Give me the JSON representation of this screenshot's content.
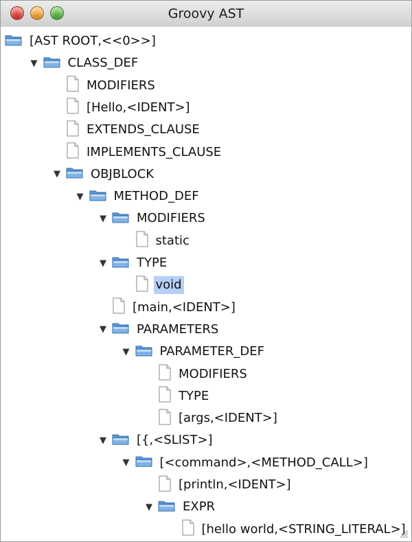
{
  "window": {
    "title": "Groovy AST"
  },
  "tree": {
    "nodes": [
      {
        "label": "[AST ROOT,<<0>>]",
        "level": 0,
        "type": "folder",
        "expanded": false
      },
      {
        "label": "CLASS_DEF",
        "level": 1,
        "type": "folder",
        "expanded": true
      },
      {
        "label": "MODIFIERS",
        "level": 2,
        "type": "leaf"
      },
      {
        "label": "[Hello,<IDENT>]",
        "level": 2,
        "type": "leaf"
      },
      {
        "label": "EXTENDS_CLAUSE",
        "level": 2,
        "type": "leaf"
      },
      {
        "label": "IMPLEMENTS_CLAUSE",
        "level": 2,
        "type": "leaf"
      },
      {
        "label": "OBJBLOCK",
        "level": 2,
        "type": "folder",
        "expanded": true
      },
      {
        "label": "METHOD_DEF",
        "level": 3,
        "type": "folder",
        "expanded": true
      },
      {
        "label": "MODIFIERS",
        "level": 4,
        "type": "folder",
        "expanded": true
      },
      {
        "label": "static",
        "level": 5,
        "type": "leaf"
      },
      {
        "label": "TYPE",
        "level": 4,
        "type": "folder",
        "expanded": true
      },
      {
        "label": "void",
        "level": 5,
        "type": "leaf",
        "selected": true
      },
      {
        "label": "[main,<IDENT>]",
        "level": 4,
        "type": "leaf"
      },
      {
        "label": "PARAMETERS",
        "level": 4,
        "type": "folder",
        "expanded": true
      },
      {
        "label": "PARAMETER_DEF",
        "level": 5,
        "type": "folder",
        "expanded": true
      },
      {
        "label": "MODIFIERS",
        "level": 6,
        "type": "leaf"
      },
      {
        "label": "TYPE",
        "level": 6,
        "type": "leaf"
      },
      {
        "label": "[args,<IDENT>]",
        "level": 6,
        "type": "leaf"
      },
      {
        "label": "[{,<SLIST>]",
        "level": 4,
        "type": "folder",
        "expanded": true
      },
      {
        "label": "[<command>,<METHOD_CALL>]",
        "level": 5,
        "type": "folder",
        "expanded": true
      },
      {
        "label": "[println,<IDENT>]",
        "level": 6,
        "type": "leaf"
      },
      {
        "label": "EXPR",
        "level": 6,
        "type": "folder",
        "expanded": true
      },
      {
        "label": "[hello world,<STRING_LITERAL>]",
        "level": 7,
        "type": "leaf"
      }
    ]
  },
  "colors": {
    "selection": "#b6cff5",
    "folder": "#7fb3e6",
    "close": "#e0443e",
    "minimize": "#f1a23a",
    "zoom": "#5bb642"
  },
  "icons": {
    "expanded": "disclosure-triangle-down-icon",
    "folder": "folder-icon",
    "leaf": "document-icon",
    "resize": "resize-grip-icon"
  }
}
